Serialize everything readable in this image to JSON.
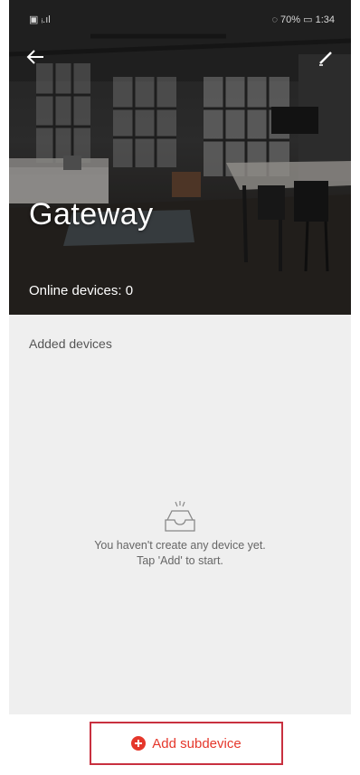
{
  "status_bar": {
    "left": "▣ ᵢ.ıl",
    "right": "◌ 70% ▭ 1:34"
  },
  "header": {
    "back_icon": "arrow-left-icon",
    "edit_icon": "pencil-icon",
    "title": "Gateway",
    "online_devices": "Online devices: 0"
  },
  "main": {
    "section_label": "Added devices",
    "empty_state": {
      "icon": "empty-inbox-icon",
      "line1": "You haven't create any device yet.",
      "line2": "Tap 'Add' to start."
    }
  },
  "footer": {
    "add_icon": "plus-circle-icon",
    "add_label": "Add subdevice"
  },
  "colors": {
    "accent": "#e5372b",
    "highlight_border": "#c8303f",
    "background": "#efefef"
  }
}
